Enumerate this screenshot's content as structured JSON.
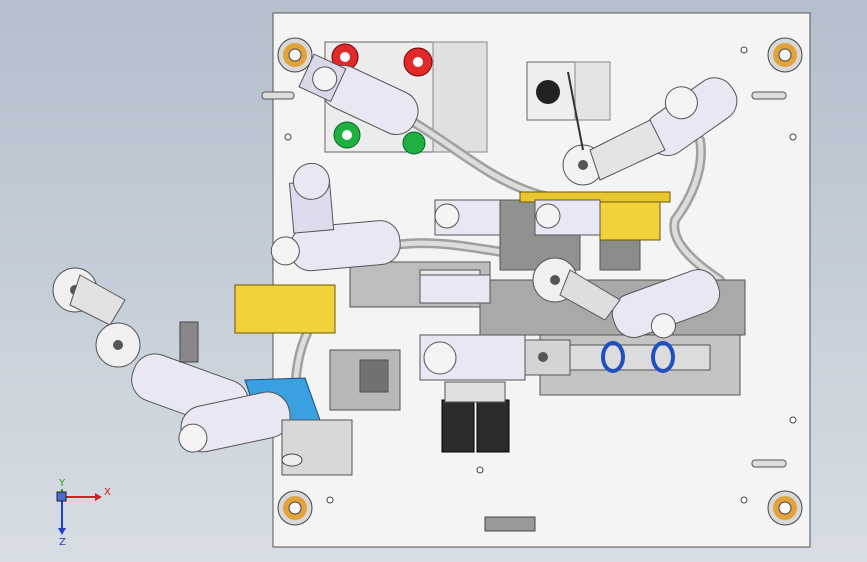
{
  "viewport": {
    "background_top": "#b3bfcc",
    "background_bottom": "#d7dde3"
  },
  "triad": {
    "x_label": "X",
    "y_label": "Y",
    "z_label": "Z",
    "x_color": "#d02020",
    "y_color": "#20a020",
    "z_color": "#2040c0"
  },
  "colors": {
    "plate": "#f4f4f4",
    "plate_edge": "#555555",
    "cylinder_body": "#e8e8f4",
    "cylinder_shadow": "#9a9ab0",
    "motor_dark": "#303030",
    "yellow_part": "#f2d23c",
    "blue_part": "#3aa0e0",
    "red_button": "#e02a2a",
    "green_button": "#20b040",
    "hose": "#c8cac8",
    "bracket_gray": "#a8aaa8"
  }
}
